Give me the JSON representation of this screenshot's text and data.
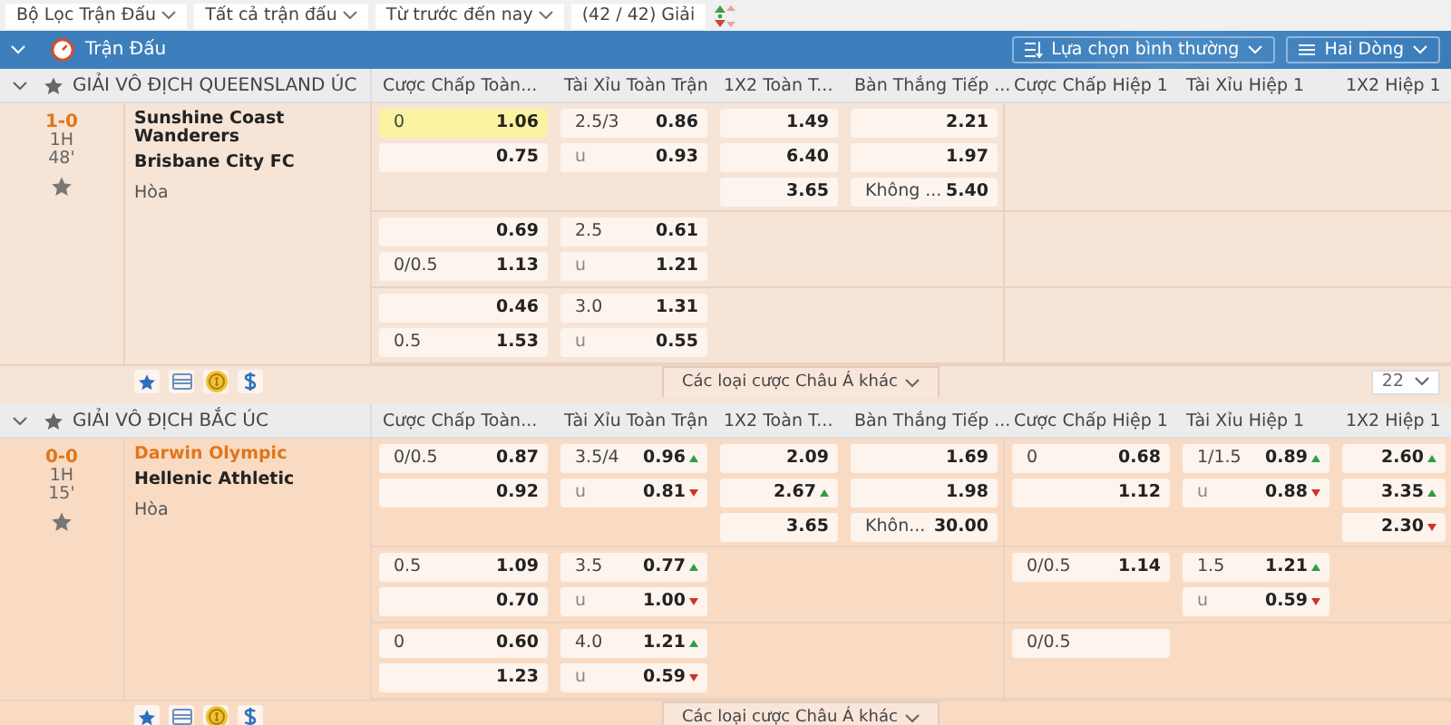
{
  "toolbar": {
    "filters": [
      {
        "label": "Bộ Lọc Trận Đấu"
      },
      {
        "label": "Tất cả trận đấu"
      },
      {
        "label": "Từ trước đến nay"
      }
    ],
    "league_count": "(42 / 42) Giải"
  },
  "header": {
    "title": "Trận Đấu",
    "options": [
      {
        "kind": "sort",
        "label": "Lựa chọn bình thường"
      },
      {
        "kind": "list",
        "label": "Hai Dòng"
      }
    ]
  },
  "leagues": [
    {
      "name": "GIẢI VÔ ĐỊCH QUEENSLAND ÚC",
      "columns": [
        "Cược Chấp Toàn...",
        "Tài Xỉu Toàn Trận",
        "1X2 Toàn T...",
        "Bàn Thắng Tiếp ...",
        "Cược Chấp Hiệp 1",
        "Tài Xỉu Hiệp 1",
        "1X2 Hiệp 1"
      ],
      "match": {
        "score": "1-0",
        "period": "1H",
        "minute": "48'",
        "home": "Sunshine Coast Wanderers",
        "away": "Brisbane City FC",
        "home_highlighted": false,
        "draw": "Hòa"
      },
      "groups": [
        {
          "ft_hdp": [
            {
              "label": "0",
              "odds": "1.06",
              "highlighted": true
            },
            {
              "odds": "0.75",
              "highlighted": false
            }
          ],
          "ft_ou": [
            {
              "label": "2.5/3",
              "odds": "0.86"
            },
            {
              "label": "u",
              "odds": "0.93"
            }
          ],
          "ft_1x2": [
            {
              "odds": "1.49"
            },
            {
              "odds": "6.40"
            },
            {
              "odds": "3.65"
            }
          ],
          "next_goal": [
            {
              "odds": "2.21"
            },
            {
              "odds": "1.97"
            },
            {
              "label": "Không ...",
              "odds": "5.40"
            }
          ]
        },
        {
          "ft_hdp": [
            {
              "odds": "0.69",
              "highlighted": false
            },
            {
              "label": "0/0.5",
              "odds": "1.13",
              "highlighted": false
            }
          ],
          "ft_ou": [
            {
              "label": "2.5",
              "odds": "0.61"
            },
            {
              "label": "u",
              "odds": "1.21"
            }
          ]
        },
        {
          "ft_hdp": [
            {
              "odds": "0.46",
              "highlighted": false
            },
            {
              "label": "0.5",
              "odds": "1.53",
              "highlighted": false
            }
          ],
          "ft_ou": [
            {
              "label": "3.0",
              "odds": "1.31"
            },
            {
              "label": "u",
              "odds": "0.55"
            }
          ]
        }
      ],
      "more_label": "Các loại cược Châu Á khác",
      "page_size": "22"
    },
    {
      "name": "GIẢI VÔ ĐỊCH BẮC ÚC",
      "columns": [
        "Cược Chấp Toàn...",
        "Tài Xỉu Toàn Trận",
        "1X2 Toàn T...",
        "Bàn Thắng Tiếp ...",
        "Cược Chấp Hiệp 1",
        "Tài Xỉu Hiệp 1",
        "1X2 Hiệp 1"
      ],
      "match": {
        "score": "0-0",
        "period": "1H",
        "minute": "15'",
        "home": "Darwin Olympic",
        "away": "Hellenic Athletic",
        "home_highlighted": true,
        "draw": "Hòa"
      },
      "groups": [
        {
          "ft_hdp": [
            {
              "label": "0/0.5",
              "odds": "0.87",
              "highlighted": false
            },
            {
              "odds": "0.92",
              "highlighted": false
            }
          ],
          "ft_ou": [
            {
              "label": "3.5/4",
              "odds": "0.96",
              "rising": true
            },
            {
              "label": "u",
              "odds": "0.81",
              "rising": false
            }
          ],
          "ft_1x2": [
            {
              "odds": "2.09"
            },
            {
              "odds": "2.67",
              "rising": true
            },
            {
              "odds": "3.65"
            }
          ],
          "next_goal": [
            {
              "odds": "1.69"
            },
            {
              "odds": "1.98"
            },
            {
              "label": "Khôn...",
              "odds": "30.00"
            }
          ],
          "h1_hdp": [
            {
              "label": "0",
              "odds": "0.68"
            },
            {
              "odds": "1.12"
            }
          ],
          "h1_ou": [
            {
              "label": "1/1.5",
              "odds": "0.89",
              "rising": true
            },
            {
              "label": "u",
              "odds": "0.88",
              "rising": false
            }
          ],
          "h1_1x2": [
            {
              "odds": "2.60",
              "rising": true
            },
            {
              "odds": "3.35",
              "rising": true
            },
            {
              "odds": "2.30",
              "rising": false
            }
          ]
        },
        {
          "ft_hdp": [
            {
              "label": "0.5",
              "odds": "1.09",
              "highlighted": false
            },
            {
              "odds": "0.70",
              "highlighted": false
            }
          ],
          "ft_ou": [
            {
              "label": "3.5",
              "odds": "0.77",
              "rising": true
            },
            {
              "label": "u",
              "odds": "1.00",
              "rising": false
            }
          ],
          "h1_hdp": [
            {
              "label": "0/0.5",
              "odds": "1.14"
            }
          ],
          "h1_ou": [
            {
              "label": "1.5",
              "odds": "1.21",
              "rising": true
            },
            {
              "label": "u",
              "odds": "0.59",
              "rising": false
            }
          ]
        },
        {
          "ft_hdp": [
            {
              "label": "0",
              "odds": "0.60",
              "highlighted": false
            },
            {
              "odds": "1.23",
              "highlighted": false
            }
          ],
          "ft_ou": [
            {
              "label": "4.0",
              "odds": "1.21",
              "rising": true
            },
            {
              "label": "u",
              "odds": "0.59",
              "rising": false
            }
          ],
          "h1_hdp": [
            {
              "label": "0/0.5"
            }
          ]
        }
      ],
      "more_label": "Các loại cược Châu Á khác"
    }
  ]
}
